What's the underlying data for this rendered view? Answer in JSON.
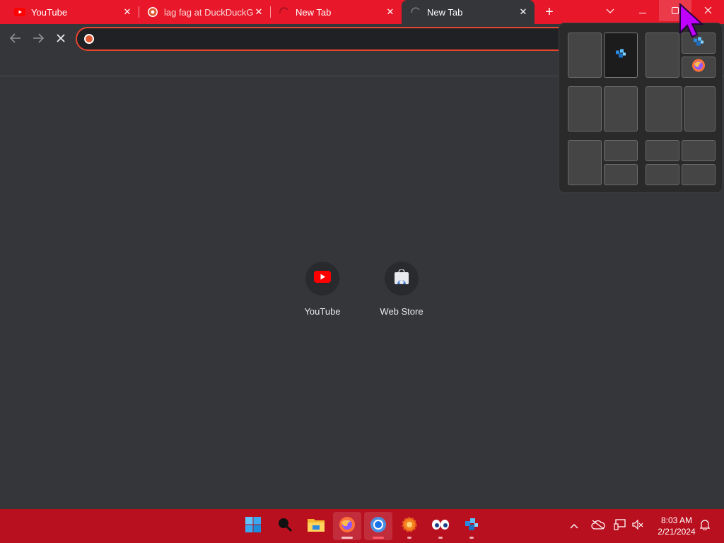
{
  "tabs": [
    {
      "title": "YouTube",
      "favicon": "youtube-icon"
    },
    {
      "title": "lag fag at DuckDuckGo",
      "favicon": "duckduckgo-icon"
    },
    {
      "title": "New Tab",
      "favicon": "loading-icon"
    },
    {
      "title": "New Tab",
      "favicon": "loading-icon",
      "active": true
    }
  ],
  "omnibox": {
    "value": "",
    "placeholder": ""
  },
  "shortcuts": [
    {
      "label": "YouTube",
      "icon": "youtube-icon"
    },
    {
      "label": "Web Store",
      "icon": "web-store-icon"
    }
  ],
  "clock": {
    "time": "8:03 AM",
    "date": "2/21/2024"
  },
  "colors": {
    "tab_strip": "#e8182a",
    "page_background": "#35363a",
    "taskbar": "#b9101f",
    "omnibox_border": "#e8452f",
    "cursor": "#c000ff"
  },
  "taskbar_apps": [
    "start-icon",
    "search-icon",
    "file-explorer-icon",
    "firefox-icon",
    "chrome-icon",
    "settings-gear-icon",
    "eyes-app-icon",
    "cube-app-icon"
  ]
}
